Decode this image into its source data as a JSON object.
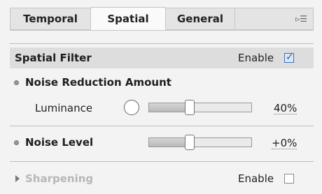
{
  "tabs": [
    {
      "label": "Temporal",
      "active": false
    },
    {
      "label": "Spatial",
      "active": true
    },
    {
      "label": "General",
      "active": false
    }
  ],
  "menu_icon": "panel-menu-icon",
  "spatial_filter": {
    "title": "Spatial Filter",
    "enable_label": "Enable",
    "enabled": true
  },
  "noise_reduction": {
    "title": "Noise Reduction Amount",
    "luminance_label": "Luminance",
    "luminance_value": "40%",
    "luminance_fraction": 0.4
  },
  "noise_level": {
    "title": "Noise Level",
    "value": "+0%",
    "fraction": 0.4
  },
  "sharpening": {
    "title": "Sharpening",
    "enable_label": "Enable",
    "enabled": false
  }
}
